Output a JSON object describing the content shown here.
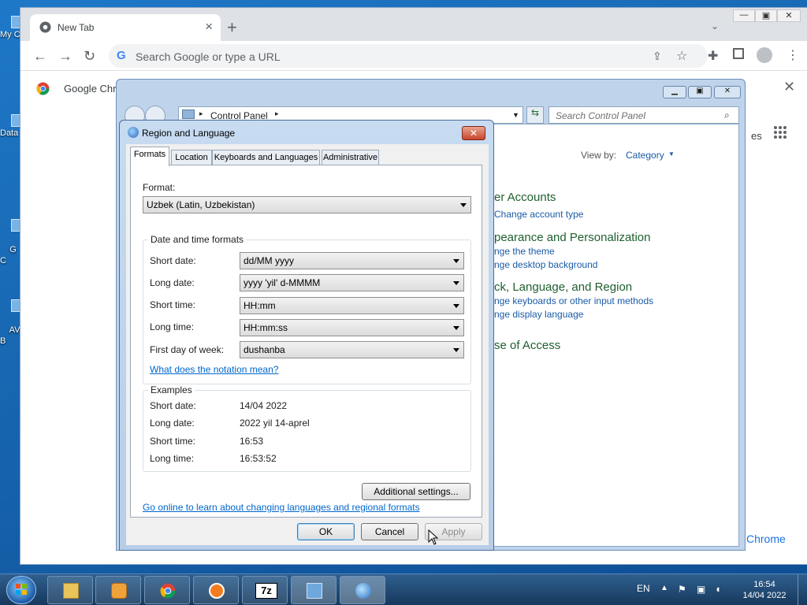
{
  "desktop": {
    "icons": [
      {
        "label": "My C",
        "icon": "computer-icon"
      },
      {
        "label": "Data",
        "icon": "folder-icon"
      },
      {
        "label": "G\nC",
        "icon": "app-icon"
      },
      {
        "label": "AV\nB",
        "icon": "antivirus-icon"
      }
    ]
  },
  "chrome": {
    "tab_title": "New Tab",
    "new_tab_glyph": "+",
    "omnibox_placeholder": "Search Google or type a URL",
    "bookmark": "Google Chr",
    "apps_link_fragment": "es",
    "bottom_link": "Chrome",
    "accent_color": "#1a73e8"
  },
  "control_panel": {
    "breadcrumb": "Control Panel",
    "search_placeholder": "Search Control Panel",
    "view_by_label": "View by:",
    "view_by_value": "Category",
    "sections": [
      {
        "heading": "er Accounts",
        "links": [
          "Change account type"
        ]
      },
      {
        "heading": "pearance and Personalization",
        "links": [
          "nge the theme",
          "nge desktop background"
        ]
      },
      {
        "heading": "ck, Language, and Region",
        "links": [
          "nge keyboards or other input methods",
          "nge display language"
        ]
      },
      {
        "heading": "se of Access",
        "links": []
      }
    ]
  },
  "dialog": {
    "title": "Region and Language",
    "close_glyph": "✕",
    "tabs": [
      "Formats",
      "Location",
      "Keyboards and Languages",
      "Administrative"
    ],
    "active_tab": "Formats",
    "format_label": "Format:",
    "format_value": "Uzbek (Latin, Uzbekistan)",
    "datetime_group": "Date and time formats",
    "fields": [
      {
        "label": "Short date:",
        "value": "dd/MM yyyy"
      },
      {
        "label": "Long date:",
        "value": "yyyy 'yil' d-MMMM"
      },
      {
        "label": "Short time:",
        "value": "HH:mm"
      },
      {
        "label": "Long time:",
        "value": "HH:mm:ss"
      },
      {
        "label": "First day of week:",
        "value": "dushanba"
      }
    ],
    "notation_link": "What does the notation mean?",
    "examples_group": "Examples",
    "examples": [
      {
        "label": "Short date:",
        "value": "14/04 2022"
      },
      {
        "label": "Long date:",
        "value": "2022 yil 14-aprel"
      },
      {
        "label": "Short time:",
        "value": "16:53"
      },
      {
        "label": "Long time:",
        "value": "16:53:52"
      }
    ],
    "additional_settings": "Additional settings...",
    "online_link": "Go online to learn about changing languages and regional formats",
    "ok": "OK",
    "cancel": "Cancel",
    "apply": "Apply"
  },
  "taskbar": {
    "items": [
      "explorer-icon",
      "media-player-icon",
      "chrome-icon",
      "avast-icon",
      "7zip-icon",
      "control-panel-icon",
      "region-globe-icon"
    ],
    "sevenzip_label": "7z",
    "language": "EN",
    "time": "16:54",
    "date": "14/04 2022"
  }
}
